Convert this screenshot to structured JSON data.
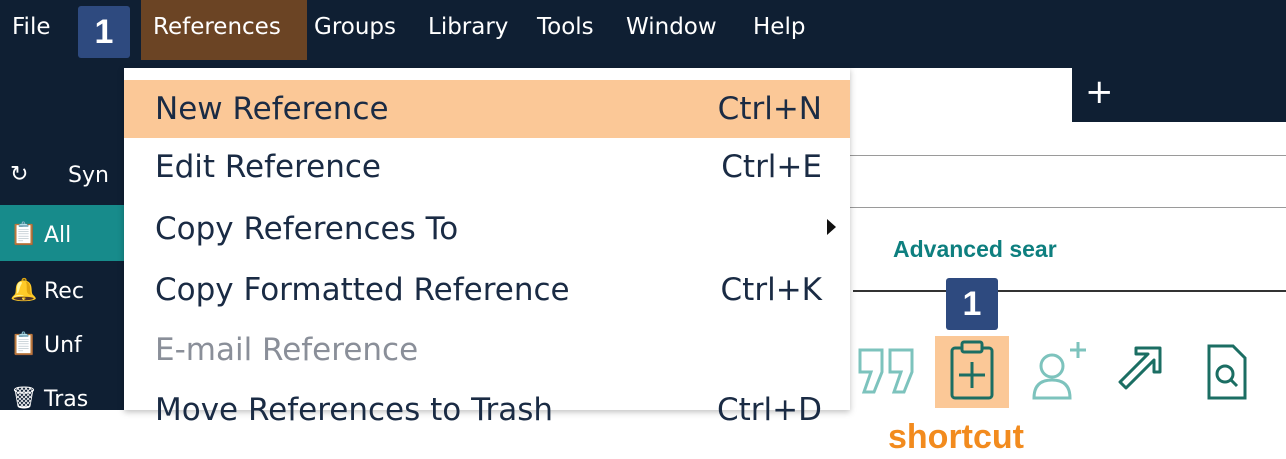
{
  "menubar": {
    "items": [
      "File",
      "References",
      "Groups",
      "Library",
      "Tools",
      "Window",
      "Help"
    ],
    "badge_label": "1",
    "active_item": "References"
  },
  "tabs": {
    "new_tab_glyph": "+"
  },
  "sidebar": {
    "items": [
      {
        "icon": "sync-icon",
        "label": "Syn"
      },
      {
        "icon": "clipboard-icon",
        "label": "All"
      },
      {
        "icon": "bell-icon",
        "label": "Rec"
      },
      {
        "icon": "clipboard-icon",
        "label": "Unf"
      },
      {
        "icon": "trash-icon",
        "label": "Tras"
      }
    ],
    "selected_index": 1
  },
  "references_menu": {
    "items": [
      {
        "label": "New Reference",
        "shortcut": "Ctrl+N",
        "highlighted": true
      },
      {
        "label": "Edit Reference",
        "shortcut": "Ctrl+E"
      },
      {
        "label": "Copy References To",
        "shortcut": "",
        "submenu": true
      },
      {
        "label": "Copy Formatted Reference",
        "shortcut": "Ctrl+K"
      },
      {
        "label": "E-mail Reference",
        "shortcut": "",
        "disabled": true
      },
      {
        "label": "Move References to Trash",
        "shortcut": "Ctrl+D"
      }
    ]
  },
  "search": {
    "advanced_label": "Advanced sear"
  },
  "toolbar": {
    "icons": [
      "quote-icon",
      "new-reference-icon",
      "add-user-icon",
      "share-arrow-icon",
      "find-document-icon"
    ],
    "badge_label": "1",
    "annotation": "shortcut"
  },
  "colors": {
    "dark_navy": "#0f1f33",
    "highlight_orange": "#fbc897",
    "menu_active_brown": "#6b4424",
    "badge_blue": "#2e4a7f",
    "teal": "#178b8b",
    "annotation_orange": "#f28b1e"
  }
}
